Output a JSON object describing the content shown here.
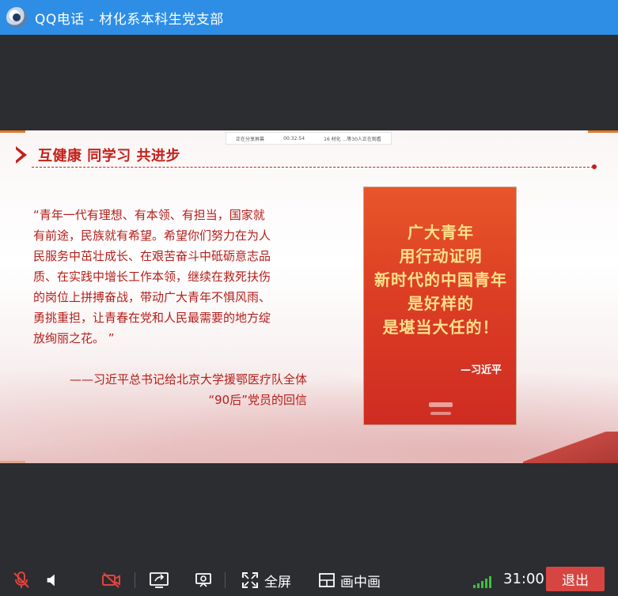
{
  "window": {
    "title": "QQ电话 - 材化系本科生党支部"
  },
  "share": {
    "status_text": "正在分享屏幕",
    "elapsed": "00:32:54",
    "viewers_text": "16 材化 ...等30人正在观看"
  },
  "slide": {
    "heading": "互健康 同学习 共进步",
    "quote_lines": [
      "“青年一代有理想、有本领、有担当，国家就",
      "有前途，民族就有希望。希望你们努力在为人",
      "民服务中茁壮成长、在艰苦奋斗中砥砺意志品",
      "质、在实践中增长工作本领，继续在救死扶伤",
      "的岗位上拼搏奋战，带动广大青年不惧风雨、",
      "勇挑重担，让青春在党和人民最需要的地方绽",
      "放绚丽之花。 ”"
    ],
    "source_lines": [
      "——习近平总书记给北京大学援鄂医疗队全体",
      "“90后”党员的回信"
    ],
    "poster": {
      "slogan_lines": [
        "广大青年",
        "用行动证明",
        "新时代的中国青年",
        "是好样的",
        "是堪当大任的！"
      ],
      "author": "—习近平"
    }
  },
  "toolbar": {
    "fullscreen_label": "全屏",
    "pip_label": "画中画",
    "timer": "31:00",
    "exit_label": "退出",
    "icons": {
      "mic": "mic-muted-icon",
      "speaker": "speaker-icon",
      "camera": "camera-off-icon",
      "share_screen": "share-screen-icon",
      "screenshot": "screenshot-icon",
      "fullscreen": "fullscreen-icon",
      "pip": "picture-in-picture-icon",
      "signal": "signal-strength-icon"
    },
    "accent_color": "#d64541",
    "signal_color": "#3cc13c"
  }
}
